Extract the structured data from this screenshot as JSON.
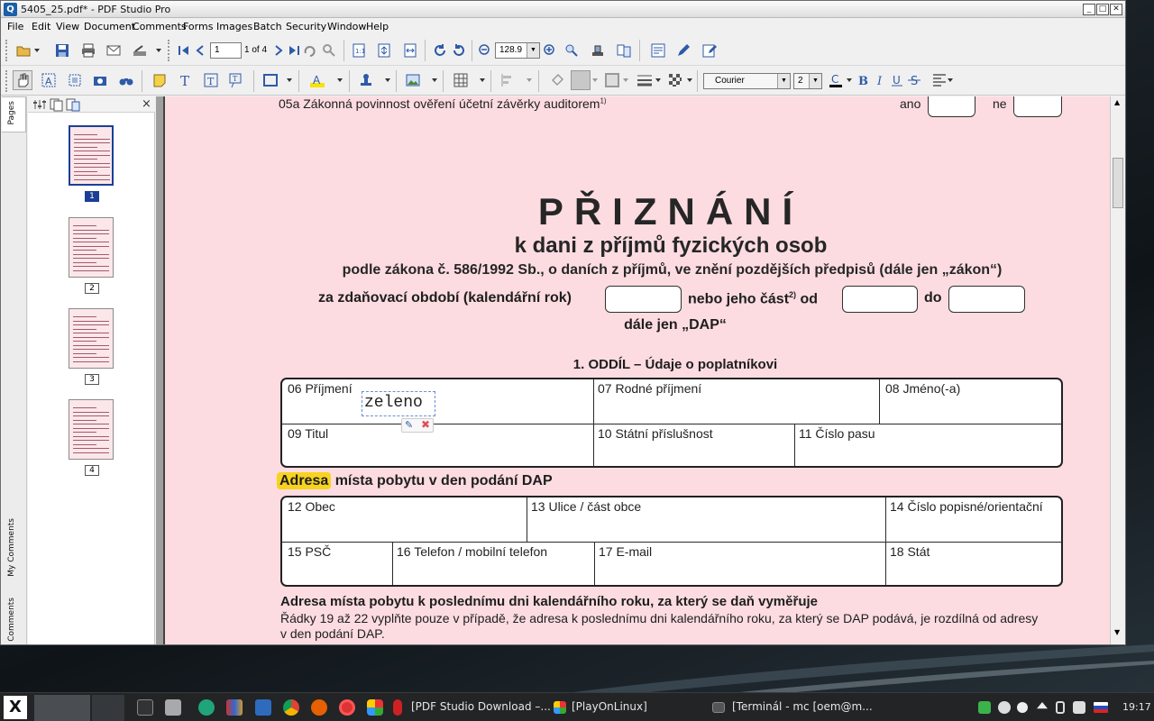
{
  "window": {
    "title": "5405_25.pdf* - PDF Studio Pro",
    "app_icon": "Q",
    "controls": [
      "_",
      "□",
      "✕"
    ]
  },
  "menu": [
    "File",
    "Edit",
    "View",
    "Document",
    "Comments",
    "Forms",
    "Images",
    "Batch",
    "Security",
    "Window",
    "Help"
  ],
  "toolbar": {
    "page_input": "1",
    "page_of": "1 of 4",
    "zoom": "128.9",
    "font_name": "Courier",
    "font_size": "2"
  },
  "side_tabs": {
    "pages": "Pages",
    "my_comments": "My Comments",
    "comments": "Comments"
  },
  "thumbnails": [
    {
      "num": "1",
      "selected": true
    },
    {
      "num": "2",
      "selected": false
    },
    {
      "num": "3",
      "selected": false
    },
    {
      "num": "4",
      "selected": false
    }
  ],
  "document": {
    "row05": "05a Zákonná povinnost ověření účetní závěrky auditorem",
    "row05_sup": "1)",
    "ano": "ano",
    "ne": "ne",
    "title": "PŘIZNÁNÍ",
    "subtitle": "k dani z příjmů fyzických osob",
    "law_line": "podle zákona č. 586/1992 Sb., o daních z příjmů, ve znění pozdějších předpisů (dále jen „zákon“)",
    "period_a": "za zdaňovací období (kalendářní rok)",
    "period_b": "nebo jeho část",
    "period_sup": "2)",
    "period_c": "od",
    "period_d": "do",
    "dap_line": "dále jen „DAP“",
    "section1": "1. ODDÍL – Údaje o poplatníkovi",
    "f06": "06 Příjmení",
    "f07": "07 Rodné příjmení",
    "f08": "08 Jméno(-a)",
    "f09": "09 Titul",
    "f10": "10 Státní příslušnost",
    "f11": "11 Číslo pasu",
    "annotation_text": "zeleno",
    "addr_highlight": "Adresa",
    "addr_rest": "místa pobytu v den podání DAP",
    "f12": "12 Obec",
    "f13": "13 Ulice / část obce",
    "f14": "14 Číslo popisné/orientační",
    "f15": "15 PSČ",
    "f16": "16 Telefon / mobilní telefon",
    "f17": "17 E-mail",
    "f18": "18 Stát",
    "addr2_title": "Adresa místa pobytu k poslednímu dni kalendářního roku, za který se daň vyměřuje",
    "addr2_note1": "Řádky 19 až 22 vyplňte pouze v případě, že adresa k poslednímu dni kalendářního roku, za který se DAP podává, je rozdílná od adresy",
    "addr2_note2": "v den podání DAP."
  },
  "taskbar": {
    "items": [
      "[PDF Studio Download –...",
      "[PlayOnLinux]",
      "[Terminál - mc [oem@m..."
    ],
    "clock": "19:17"
  },
  "colors": {
    "page_bg": "#fcdce1",
    "highlight": "#f7d21e",
    "selection": "#1c3f95"
  }
}
